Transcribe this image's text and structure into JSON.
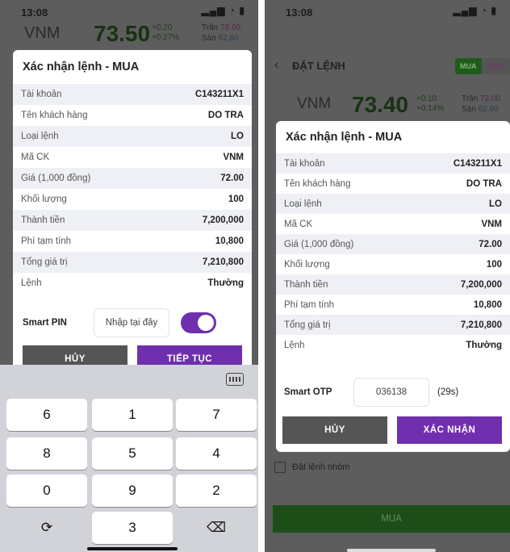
{
  "left": {
    "status": {
      "time": "13:08",
      "icons": "▂▄▆ ◔ ▮"
    },
    "ticker": {
      "symbol": "VNM",
      "price": "73.50",
      "change_abs": "+0.20",
      "change_pct": "+0.27%",
      "ceiling_label": "Trần",
      "ceiling_value": "78.60",
      "floor_label": "Sàn",
      "floor_value": "62.60"
    },
    "modal": {
      "title": "Xác nhận lệnh - MUA",
      "rows": [
        {
          "label": "Tài khoản",
          "value": "C143211X1"
        },
        {
          "label": "Tên khách hàng",
          "value": "DO TRA"
        },
        {
          "label": "Loại lệnh",
          "value": "LO"
        },
        {
          "label": "Mã CK",
          "value": "VNM"
        },
        {
          "label": "Giá (1,000 đồng)",
          "value": "72.00"
        },
        {
          "label": "Khối lượng",
          "value": "100"
        },
        {
          "label": "Thành tiền",
          "value": "7,200,000"
        },
        {
          "label": "Phí tạm tính",
          "value": "10,800"
        },
        {
          "label": "Tổng giá trị",
          "value": "7,210,800"
        },
        {
          "label": "Lệnh",
          "value": "Thường"
        }
      ],
      "pin_label": "Smart PIN",
      "pin_placeholder": "Nhập tại đây",
      "cancel": "HỦY",
      "next": "TIẾP TỤC"
    },
    "keyboard": {
      "keys": [
        "6",
        "1",
        "7",
        "8",
        "5",
        "4",
        "0",
        "9",
        "2",
        "3"
      ],
      "refresh_glyph": "⟳",
      "delete_glyph": "⌫"
    }
  },
  "right": {
    "status": {
      "time": "13:08",
      "icons": "▂▄▆ ◔ ▮"
    },
    "header": {
      "back_glyph": "‹",
      "title": "ĐẶT LỆNH",
      "buy_tab": "MUA",
      "sell_tab": "BÁN"
    },
    "ticker": {
      "symbol": "VNM",
      "price": "73.40",
      "change_abs": "+0.10",
      "change_pct": "+0.14%",
      "ceiling_label": "Trần",
      "ceiling_value": "72.00",
      "floor_label": "Sàn",
      "floor_value": "62.60"
    },
    "modal": {
      "title": "Xác nhận lệnh - MUA",
      "rows": [
        {
          "label": "Tài khoản",
          "value": "C143211X1"
        },
        {
          "label": "Tên khách hàng",
          "value": "DO TRA"
        },
        {
          "label": "Loại lệnh",
          "value": "LO"
        },
        {
          "label": "Mã CK",
          "value": "VNM"
        },
        {
          "label": "Giá (1,000 đồng)",
          "value": "72.00"
        },
        {
          "label": "Khối lượng",
          "value": "100"
        },
        {
          "label": "Thành tiền",
          "value": "7,200,000"
        },
        {
          "label": "Phí tạm tính",
          "value": "10,800"
        },
        {
          "label": "Tổng giá trị",
          "value": "7,210,800"
        },
        {
          "label": "Lệnh",
          "value": "Thường"
        }
      ],
      "otp_label": "Smart OTP",
      "otp_value": "036138",
      "otp_countdown": "(29s)",
      "cancel": "HỦY",
      "confirm": "XÁC NHẬN"
    },
    "group_order_label": "Đặt lệnh nhóm",
    "buy_button": "MUA"
  }
}
